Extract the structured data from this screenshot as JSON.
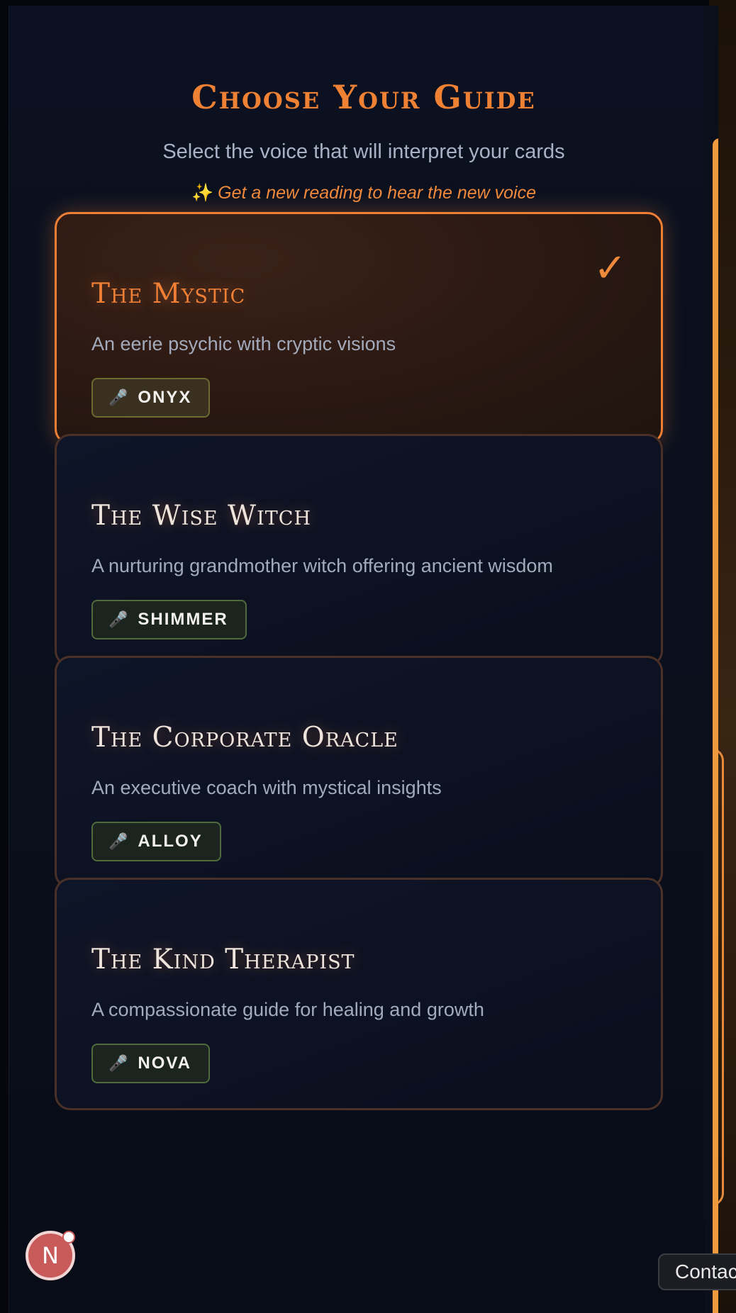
{
  "header": {
    "title": "Choose Your Guide",
    "subtitle": "Select the voice that will interpret your cards",
    "note_icon": "✨",
    "note": "Get a new reading to hear the new voice"
  },
  "guides": [
    {
      "name": "The Mystic",
      "description": "An eerie psychic with cryptic visions",
      "voice": "ONYX",
      "selected": true
    },
    {
      "name": "The Wise Witch",
      "description": "A nurturing grandmother witch offering ancient wisdom",
      "voice": "SHIMMER",
      "selected": false
    },
    {
      "name": "The Corporate Oracle",
      "description": "An executive coach with mystical insights",
      "voice": "ALLOY",
      "selected": false
    },
    {
      "name": "The Kind Therapist",
      "description": "A compassionate guide for healing and growth",
      "voice": "NOVA",
      "selected": false
    }
  ],
  "icons": {
    "mic": "microphone-icon",
    "check": "checkmark-icon",
    "mic_glyph": "🎤",
    "check_glyph": "✓"
  },
  "avatar": {
    "letter": "N"
  },
  "contact": {
    "label": "Contac"
  },
  "colors": {
    "accent": "#ee7f35",
    "background": "#0a0f1c",
    "scrollbar": "#ef9a3c"
  }
}
